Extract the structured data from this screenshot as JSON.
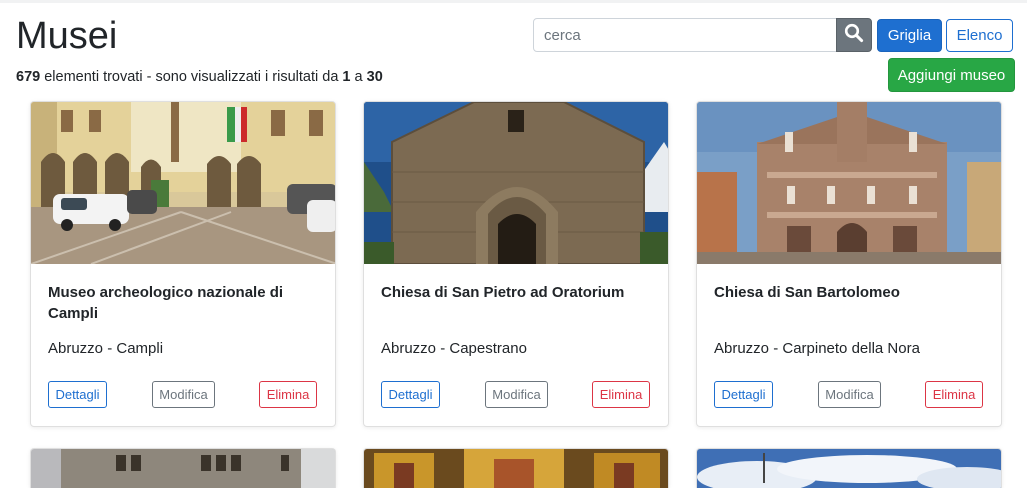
{
  "page": {
    "title": "Musei",
    "count_total": "679",
    "count_text_1": "elementi trovati - sono visualizzati i risultati da",
    "count_from": "1",
    "count_text_2": "a",
    "count_to": "30"
  },
  "search": {
    "placeholder": "cerca",
    "button_icon": "search-icon"
  },
  "view_buttons": {
    "grid_label": "Griglia",
    "list_label": "Elenco"
  },
  "add_button": {
    "label": "Aggiungi museo"
  },
  "colors": {
    "primary": "#1e6fd0",
    "success": "#28a745",
    "danger": "#dc3545",
    "secondary": "#6c757d"
  },
  "cards": [
    {
      "title": "Museo archeologico nazionale di Campli",
      "location": "Abruzzo - Campli",
      "details_label": "Dettagli",
      "edit_label": "Modifica",
      "delete_label": "Elimina"
    },
    {
      "title": "Chiesa di San Pietro ad Oratorium",
      "location": "Abruzzo - Capestrano",
      "details_label": "Dettagli",
      "edit_label": "Modifica",
      "delete_label": "Elimina"
    },
    {
      "title": "Chiesa di San Bartolomeo",
      "location": "Abruzzo - Carpineto della Nora",
      "details_label": "Dettagli",
      "edit_label": "Modifica",
      "delete_label": "Elimina"
    }
  ]
}
